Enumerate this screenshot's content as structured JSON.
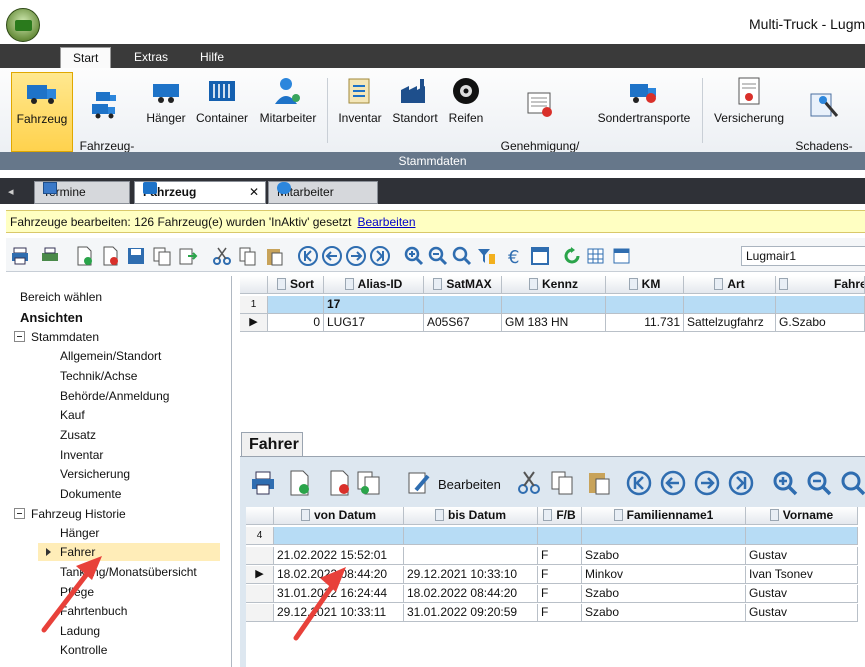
{
  "window": {
    "title": "Multi-Truck - Lugm"
  },
  "ribbon_tabs": [
    "Start",
    "Extras",
    "Hilfe"
  ],
  "ribbon_buttons": [
    {
      "label": "Fahrzeug",
      "icon": "truck-icon"
    },
    {
      "label": "Fahrzeug-\ngruppe",
      "icon": "truck-group-icon"
    },
    {
      "label": "Hänger",
      "icon": "trailer-icon"
    },
    {
      "label": "Container",
      "icon": "container-icon"
    },
    {
      "label": "Mitarbeiter",
      "icon": "employee-icon"
    },
    {
      "label": "Inventar",
      "icon": "inventory-icon"
    },
    {
      "label": "Standort",
      "icon": "location-icon"
    },
    {
      "label": "Reifen",
      "icon": "tire-icon"
    },
    {
      "label": "Genehmigung/\nZertifikat",
      "icon": "certificate-icon"
    },
    {
      "label": "Sondertransporte",
      "icon": "special-transport-icon"
    },
    {
      "label": "Versicherung",
      "icon": "insurance-icon"
    },
    {
      "label": "Schadens-\nfälle",
      "icon": "damage-icon"
    }
  ],
  "ribbon_group": "Stammdaten",
  "doc_tabs": [
    {
      "label": "Termine"
    },
    {
      "label": "Fahrzeug"
    },
    {
      "label": "Mitarbeiter"
    }
  ],
  "info": {
    "text": "Fahrzeuge bearbeiten: 126 Fahrzeug(e) wurden 'InAktiv' gesetzt",
    "link": "Bearbeiten"
  },
  "filter_combo": "Lugmair1",
  "left": {
    "area_title": "Bereich wählen",
    "views_title": "Ansichten",
    "groups": [
      {
        "label": "Stammdaten",
        "items": [
          "Allgemein/Standort",
          "Technik/Achse",
          "Behörde/Anmeldung",
          "Kauf",
          "Zusatz",
          "Inventar",
          "Versicherung",
          "Dokumente"
        ]
      },
      {
        "label": "Fahrzeug Historie",
        "items": [
          "Hänger",
          "Fahrer",
          "Tankung/Monatsübersicht",
          "Pflege",
          "Fahrtenbuch",
          "Ladung",
          "Kontrolle"
        ]
      }
    ],
    "selected": "Fahrer"
  },
  "grid1": {
    "columns": [
      "Sort",
      "Alias-ID",
      "SatMAX",
      "Kennz",
      "KM",
      "Art",
      "Fahrer"
    ],
    "filter_row_num": "1",
    "filter_alias": "17",
    "rows": [
      [
        "0",
        "LUG17",
        "A05S67",
        "GM 183 HN",
        "11.731",
        "Sattelzugfahrz",
        "G.Szabo"
      ]
    ]
  },
  "pane2": {
    "tab": "Fahrer",
    "edit_label": "Bearbeiten",
    "columns": [
      "von Datum",
      "bis Datum",
      "F/B",
      "Familienname1",
      "Vorname"
    ],
    "filter_row_num": "4",
    "rows": [
      [
        "21.02.2022 15:52:01",
        "",
        "F",
        "Szabo",
        "Gustav"
      ],
      [
        "18.02.2022 08:44:20",
        "29.12.2021 10:33:10",
        "F",
        "Minkov",
        "Ivan Tsonev"
      ],
      [
        "31.01.2022 16:24:44",
        "18.02.2022 08:44:20",
        "F",
        "Szabo",
        "Gustav"
      ],
      [
        "29.12.2021 10:33:11",
        "31.01.2022 09:20:59",
        "F",
        "Szabo",
        "Gustav"
      ]
    ]
  },
  "colors": {
    "ribbon_tab_bar": "#3a3a3a",
    "selected_yellow": "#ffd24d",
    "info_bar": "#ffffc2",
    "filter_row": "#b7dcf5",
    "annotation_arrow": "#e8413a"
  }
}
